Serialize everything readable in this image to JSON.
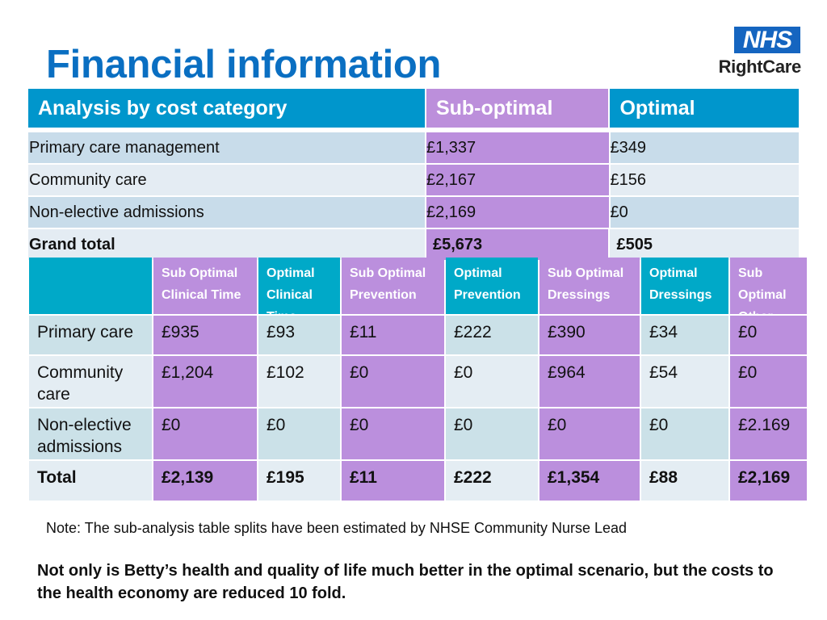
{
  "title": "Financial information",
  "logo": {
    "top": "NHS",
    "bottom": "RightCare"
  },
  "summary_table": {
    "headers": [
      "Analysis by cost category",
      "Sub-optimal",
      "Optimal"
    ],
    "rows": [
      {
        "label": "Primary care management",
        "sub_optimal": "£1,337",
        "optimal": "£349"
      },
      {
        "label": "Community care",
        "sub_optimal": "£2,167",
        "optimal": "£156"
      },
      {
        "label": "Non-elective admissions",
        "sub_optimal": "£2,169",
        "optimal": "£0"
      }
    ],
    "total": {
      "label": "Grand total",
      "sub_optimal": "£5,673",
      "optimal": "£505"
    }
  },
  "breakdown_table": {
    "headers": [
      "",
      "Sub Optimal Clinical Time",
      "Optimal Clinical Time",
      "Sub Optimal Prevention",
      "Optimal Prevention",
      "Sub Optimal Dressings",
      "Optimal Dressings",
      "Sub Optimal Other"
    ],
    "rows": [
      {
        "cells": [
          "Primary care",
          "£935",
          "£93",
          "£11",
          "£222",
          "£390",
          "£34",
          "£0"
        ]
      },
      {
        "cells": [
          "Community care",
          "£1,204",
          "£102",
          "£0",
          "£0",
          "£964",
          "£54",
          "£0"
        ]
      },
      {
        "cells": [
          "Non-elective admissions",
          "£0",
          "£0",
          "£0",
          "£0",
          "£0",
          "£0",
          "£2.169"
        ]
      },
      {
        "cells": [
          "Total",
          "£2,139",
          "£195",
          "£11",
          "£222",
          "£1,354",
          "£88",
          "£2,169"
        ]
      }
    ]
  },
  "note": "Note: The sub-analysis table splits have been estimated by NHSE Community Nurse Lead",
  "conclusion": "Not only is Betty’s health and quality of life much better in the optimal scenario, but the costs to the health economy are reduced 10 fold.",
  "colors": {
    "title": "#0a6fc2",
    "header_blue": "#0096cc",
    "header_teal": "#00a9c8",
    "purple": "#bb8fdd",
    "row_light_a": "#c8dcea",
    "row_light_b": "#e4ecf3"
  }
}
